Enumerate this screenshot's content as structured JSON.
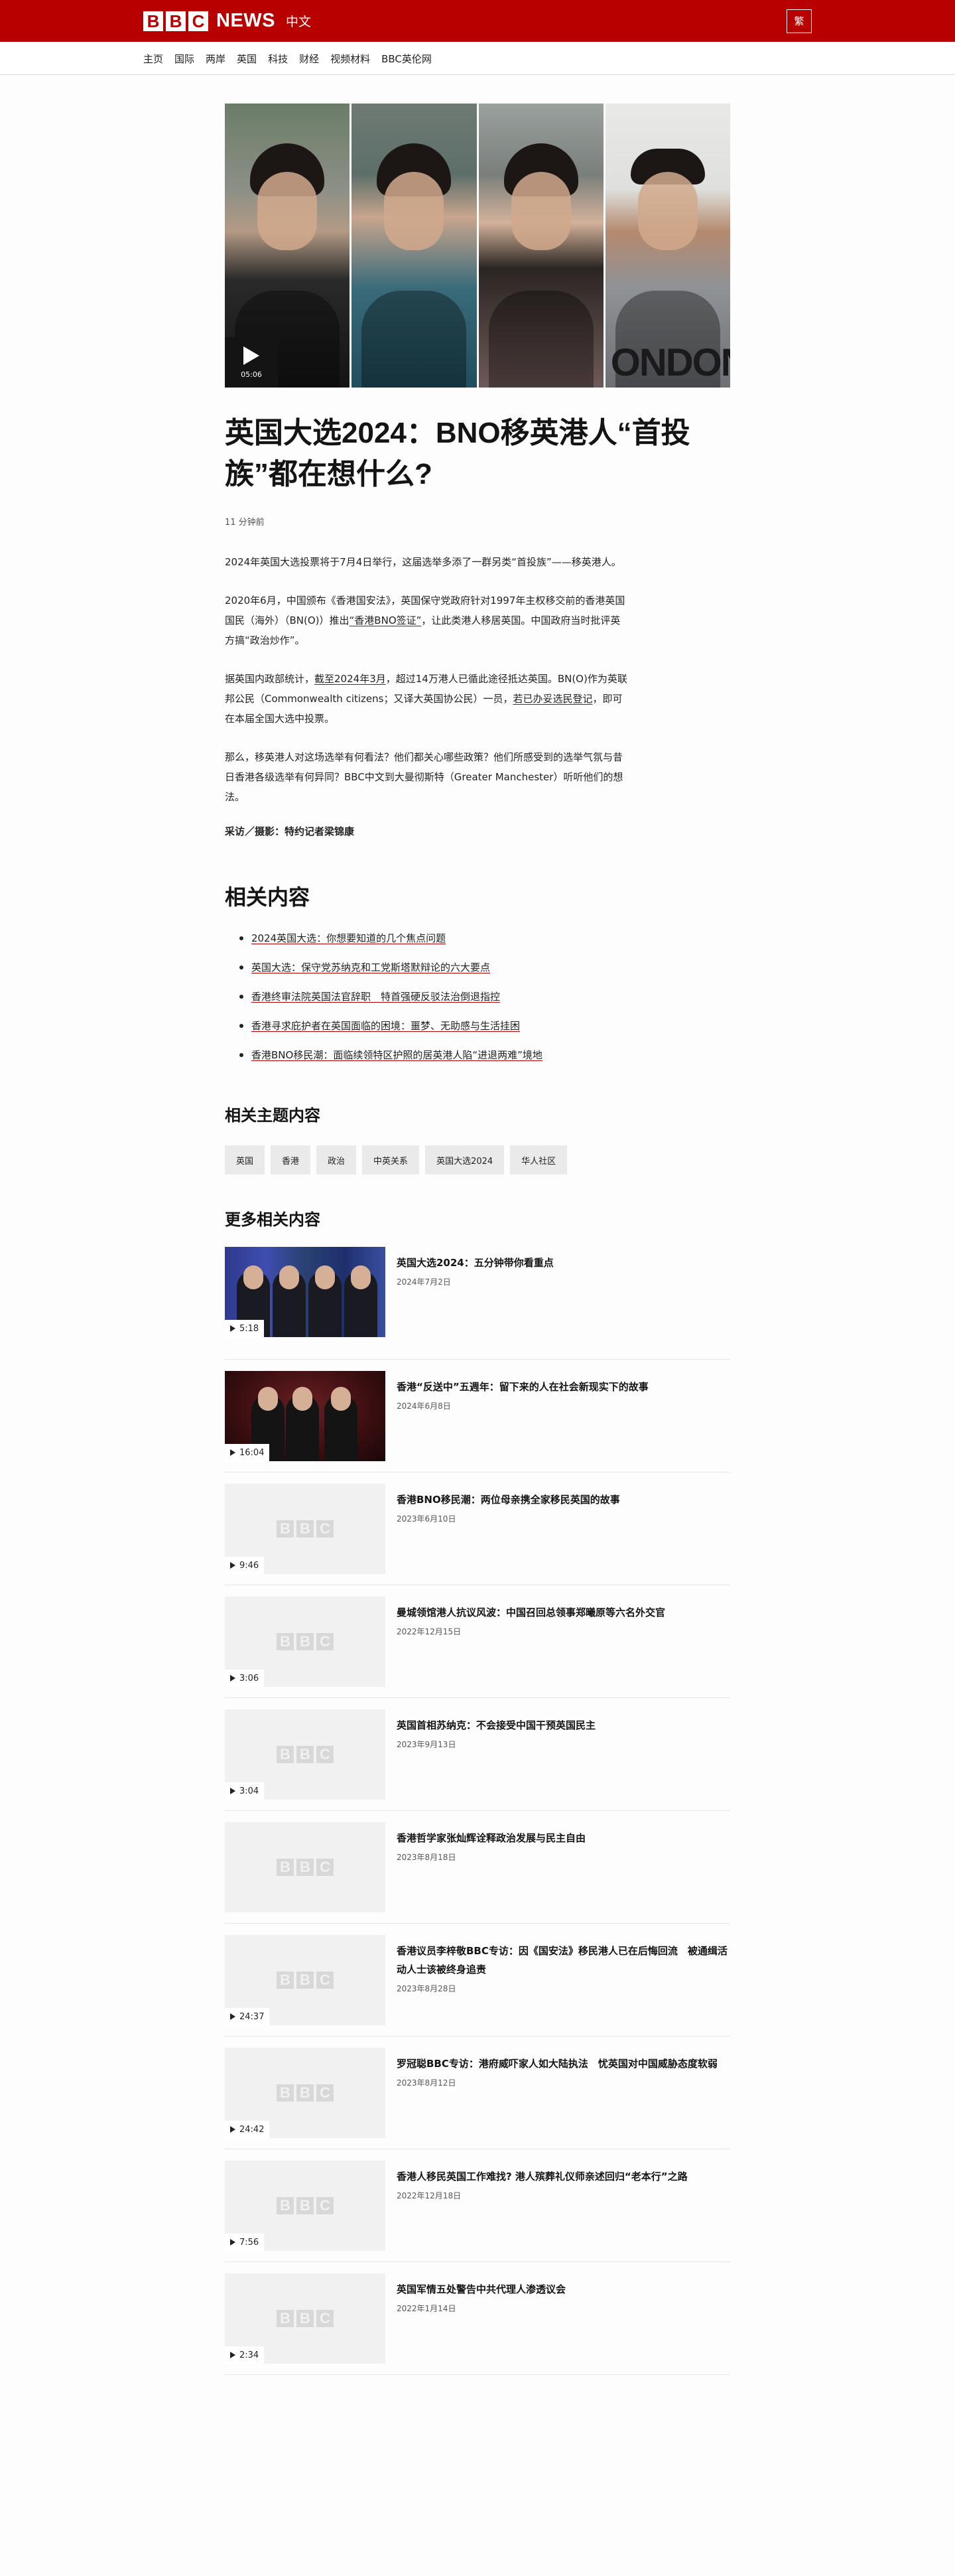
{
  "masthead": {
    "logo_letters": [
      "B",
      "B",
      "C"
    ],
    "news_word": "NEWS",
    "language": "中文",
    "script_toggle": "繁"
  },
  "nav": {
    "items": [
      "主页",
      "国际",
      "两岸",
      "英国",
      "科技",
      "财经",
      "视频材料",
      "BBC英伦网"
    ]
  },
  "article": {
    "video_duration": "05:06",
    "portrait_text": "ONDON",
    "headline": "英国大选2024：BNO移英港人“首投族”都在想什么?",
    "timestamp": "11 分钟前",
    "paragraphs": [
      {
        "parts": [
          {
            "text": "2024年英国大选投票将于7月4日举行，这届选举多添了一群另类“首投族”——移英港人。"
          }
        ]
      },
      {
        "parts": [
          {
            "text": "2020年6月，中国颁布《香港国安法》，英国保守党政府针对1997年主权移交前的香港英国国民（海外）（BN(O)）推出"
          },
          {
            "text": "“香港BNO签证”",
            "link": true
          },
          {
            "text": "，让此类港人移居英国。中国政府当时批评英方搞“政治炒作”。"
          }
        ]
      },
      {
        "parts": [
          {
            "text": "据英国内政部统计，"
          },
          {
            "text": "截至2024年3月",
            "link": true
          },
          {
            "text": "，超过14万港人已循此途径抵达英国。BN(O)作为英联邦公民（Commonwealth citizens；又译大英国协公民）一员，"
          },
          {
            "text": "若已办妥选民登记",
            "link": true
          },
          {
            "text": "，即可在本届全国大选中投票。"
          }
        ]
      },
      {
        "parts": [
          {
            "text": "那么，移英港人对这场选举有何看法？他们都关心哪些政策？他们所感受到的选举气氛与昔日香港各级选举有何异同？BBC中文到大曼彻斯特（Greater Manchester）听听他们的想法。"
          }
        ]
      }
    ],
    "credit": "采访／摄影：特约记者梁锦康"
  },
  "related": {
    "heading": "相关内容",
    "items": [
      "2024英国大选：你想要知道的几个焦点问题",
      "英国大选：保守党苏纳克和工党斯塔默辩论的六大要点",
      "香港终审法院英国法官辞职　特首强硬反驳法治倒退指控",
      "香港寻求庇护者在英国面临的困境：噩梦、无助感与生活挂困",
      "香港BNO移民潮：面临续领特区护照的居英港人陷“进退两难”境地"
    ]
  },
  "topics": {
    "heading": "相关主题内容",
    "items": [
      "英国",
      "香港",
      "政治",
      "中英关系",
      "英国大选2024",
      "华人社区"
    ]
  },
  "more": {
    "heading": "更多相关内容",
    "placeholder_letters": [
      "B",
      "B",
      "C"
    ],
    "cards": [
      {
        "title": "英国大选2024：五分钟带你看重点",
        "date": "2024年7月2日",
        "duration": "5:18",
        "thumb": "politicians-photo"
      },
      {
        "title": "香港“反送中”五週年：留下来的人在社会新现实下的故事",
        "date": "2024年6月8日",
        "duration": "16:04",
        "thumb": "group-photo"
      },
      {
        "title": "香港BNO移民潮：两位母亲携全家移民英国的故事",
        "date": "2023年6月10日",
        "duration": "9:46",
        "thumb": "placeholder"
      },
      {
        "title": "曼城领馆港人抗议风波：中国召回总领事郑曦原等六名外交官",
        "date": "2022年12月15日",
        "duration": "3:06",
        "thumb": "placeholder"
      },
      {
        "title": "英国首相苏纳克：不会接受中国干预英国民主",
        "date": "2023年9月13日",
        "duration": "3:04",
        "thumb": "placeholder"
      },
      {
        "title": "香港哲学家张灿辉诠释政治发展与民主自由",
        "date": "2023年8月18日",
        "duration": "",
        "thumb": "placeholder"
      },
      {
        "title": "香港议员李梓敬BBC专访：因《国安法》移民港人已在后悔回流　被通缉活动人士该被终身追责",
        "date": "2023年8月28日",
        "duration": "24:37",
        "thumb": "placeholder"
      },
      {
        "title": "罗冠聪BBC专访：港府威吓家人如大陆执法　忧英国对中国威胁态度软弱",
        "date": "2023年8月12日",
        "duration": "24:42",
        "thumb": "placeholder"
      },
      {
        "title": "香港人移民英国工作难找? 港人殡葬礼仪师亲述回归“老本行”之路",
        "date": "2022年12月18日",
        "duration": "7:56",
        "thumb": "placeholder"
      },
      {
        "title": "英国军情五处警告中共代理人渗透议会",
        "date": "2022年1月14日",
        "duration": "2:34",
        "thumb": "placeholder"
      }
    ]
  }
}
